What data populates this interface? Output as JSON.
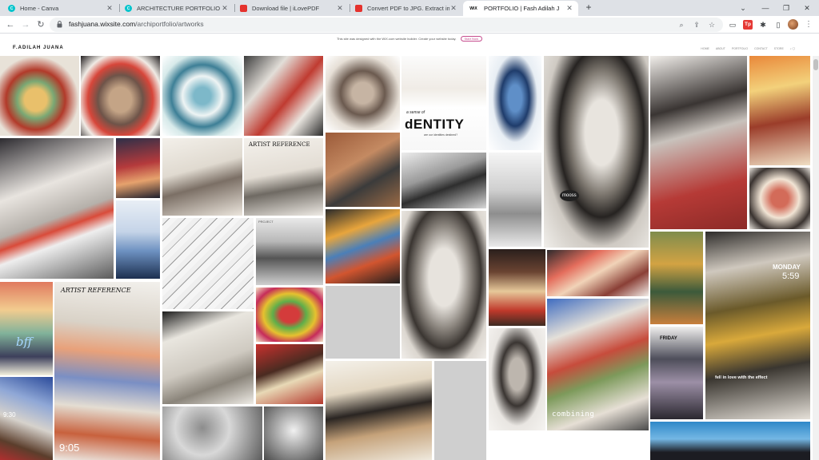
{
  "browser": {
    "tabs": [
      {
        "title": "Home - Canva",
        "favicon": "canva-icon",
        "fav_color": "#00c4cc",
        "fav_text": "C",
        "active": false
      },
      {
        "title": "ARCHITECTURE PORTFOLIO - De",
        "favicon": "canva-icon",
        "fav_color": "#00c4cc",
        "fav_text": "C",
        "active": false
      },
      {
        "title": "Download file | iLovePDF",
        "favicon": "ilovepdf-icon",
        "fav_color": "#e5322d",
        "fav_text": "",
        "active": false
      },
      {
        "title": "Convert PDF to JPG. Extract imag",
        "favicon": "ilovepdf-icon",
        "fav_color": "#e5322d",
        "fav_text": "",
        "active": false
      },
      {
        "title": "PORTFOLIO | Fash Adilah J",
        "favicon": "wix-icon",
        "fav_color": "#000000",
        "fav_text": "WiX",
        "active": true
      }
    ],
    "new_tab_glyph": "+",
    "window_controls": [
      "⌄",
      "—",
      "❐",
      "✕"
    ],
    "nav": {
      "back": "←",
      "forward": "→",
      "reload": "↻"
    },
    "url_host": "fashjuana.wixsite.com",
    "url_path": "/archiportfolio/artworks",
    "omnibox_icons": {
      "zoom": "⌕",
      "share": "⇪",
      "star": "☆"
    },
    "extensions": {
      "tab_search": "▭",
      "tp": "Tp",
      "puzzle": "✱",
      "sidebar": "▯"
    },
    "menu_glyph": "⋮"
  },
  "wix_banner": {
    "text": "This site was designed with the WiX.com website builder. Create your website today.",
    "button": "Start Now"
  },
  "site": {
    "logo": "F.ADILAH JUANA",
    "nav": [
      "HOME",
      "ABOUT",
      "PORTFOLIO",
      "CONTACT",
      "STORE"
    ],
    "nav_icons": "⌕ ◯"
  },
  "gallery_overlays": {
    "identity_a": "a sense of",
    "identity_b": "dENTITY",
    "identity_c": "are our identities destined?",
    "project": "PROJECT",
    "artist_ref": "ARTIST REFERENCE",
    "mooss": "mooss",
    "bff": "bff",
    "artist_ref2": "ARTIST REFERENCE",
    "time1": "9:05",
    "time2": "9:30",
    "monday": "MONDAY",
    "time3": "5:59",
    "fell": "fell in love with the effect",
    "friday": "FRIDAY",
    "combining": "combining"
  }
}
